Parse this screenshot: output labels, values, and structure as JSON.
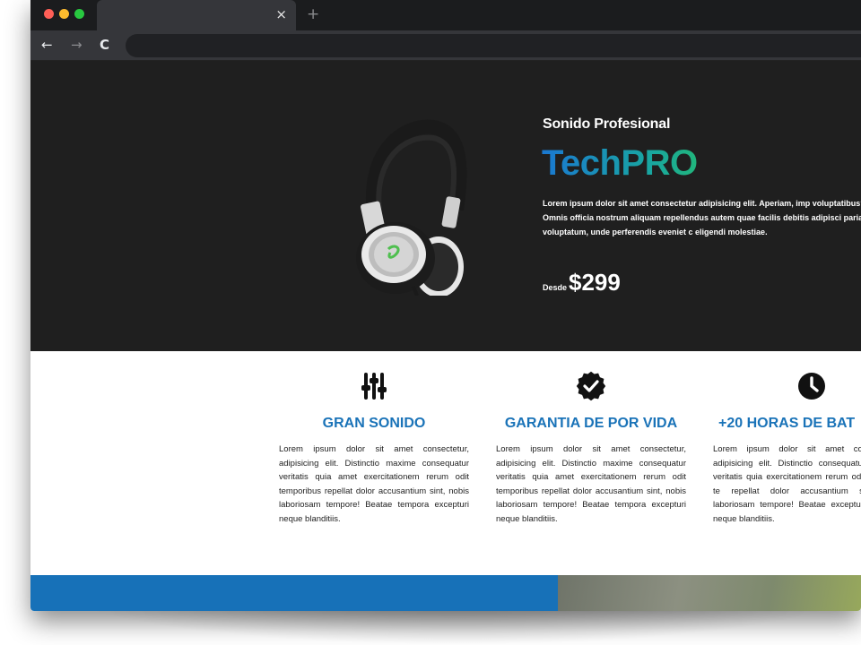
{
  "browser": {
    "tab_close_glyph": "×",
    "new_tab_glyph": "+",
    "back_glyph": "←",
    "forward_glyph": "→",
    "reload_glyph": "C",
    "address": ""
  },
  "hero": {
    "eyebrow": "Sonido Profesional",
    "brand": "TechPRO",
    "description": "Lorem ipsum dolor sit amet consectetur adipisicing elit. Aperiam, imp voluptatibus? Omnis officia nostrum aliquam repellendus autem quae facilis debitis adipisci pariatur voluptatum, unde perferendis eveniet c eligendi molestiae.",
    "price_prefix": "Desde",
    "price": "$299",
    "image_icon": "headphones-icon"
  },
  "features": [
    {
      "icon": "sliders-icon",
      "title": "GRAN SONIDO",
      "text": "Lorem ipsum dolor sit amet consectetur, adipisicing elit. Distinctio maxime consequatur veritatis quia amet exercitationem rerum odit temporibus repellat dolor accusantium sint, nobis laboriosam tempore! Beatae tempora excepturi neque blanditiis."
    },
    {
      "icon": "check-badge-icon",
      "title": "GARANTIA DE POR VIDA",
      "text": "Lorem ipsum dolor sit amet consectetur, adipisicing elit. Distinctio maxime consequatur veritatis quia amet exercitationem rerum odit temporibus repellat dolor accusantium sint, nobis laboriosam tempore! Beatae tempora excepturi neque blanditiis."
    },
    {
      "icon": "clock-icon",
      "title": "+20 HORAS DE BAT",
      "text": "Lorem ipsum dolor sit amet cor adipisicing elit. Distinctio consequatur veritatis quia exercitationem rerum odit te repellat dolor accusantium si laboriosam tempore! Beatae excepturi neque blanditiis."
    }
  ],
  "colors": {
    "accent": "#1a73b8",
    "hero_bg": "#1f1f1f",
    "brand_gradient_start": "#1a78d1",
    "brand_gradient_end": "#21b57c"
  }
}
